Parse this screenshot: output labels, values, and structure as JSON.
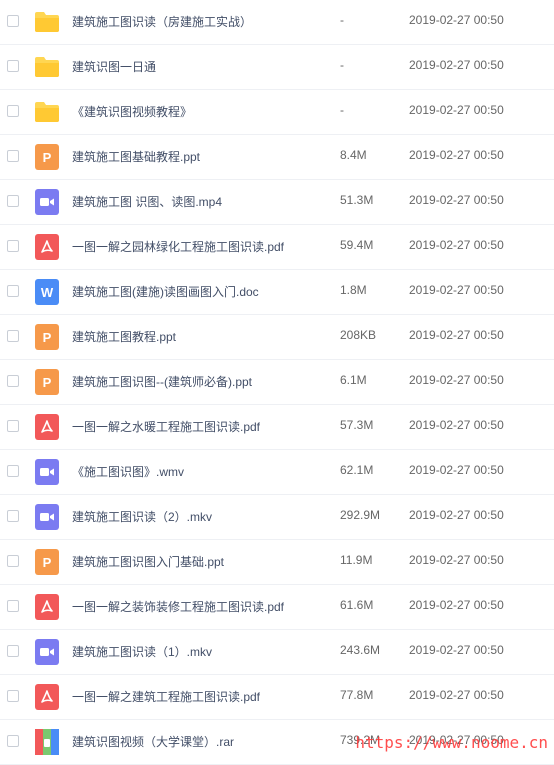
{
  "files": [
    {
      "name": "建筑施工图识读（房建施工实战）",
      "size": "-",
      "date": "2019-02-27 00:50",
      "type": "folder",
      "icon": "folder-icon"
    },
    {
      "name": "建筑识图一日通",
      "size": "-",
      "date": "2019-02-27 00:50",
      "type": "folder",
      "icon": "folder-icon"
    },
    {
      "name": "《建筑识图视频教程》",
      "size": "-",
      "date": "2019-02-27 00:50",
      "type": "folder",
      "icon": "folder-icon"
    },
    {
      "name": "建筑施工图基础教程.ppt",
      "size": "8.4M",
      "date": "2019-02-27 00:50",
      "type": "ppt",
      "icon": "ppt-file-icon"
    },
    {
      "name": "建筑施工图 识图、读图.mp4",
      "size": "51.3M",
      "date": "2019-02-27 00:50",
      "type": "video",
      "icon": "video-file-icon"
    },
    {
      "name": "一图一解之园林绿化工程施工图识读.pdf",
      "size": "59.4M",
      "date": "2019-02-27 00:50",
      "type": "pdf",
      "icon": "pdf-file-icon"
    },
    {
      "name": "建筑施工图(建施)读图画图入门.doc",
      "size": "1.8M",
      "date": "2019-02-27 00:50",
      "type": "doc",
      "icon": "word-file-icon"
    },
    {
      "name": "建筑施工图教程.ppt",
      "size": "208KB",
      "date": "2019-02-27 00:50",
      "type": "ppt",
      "icon": "ppt-file-icon"
    },
    {
      "name": "建筑施工图识图--(建筑师必备).ppt",
      "size": "6.1M",
      "date": "2019-02-27 00:50",
      "type": "ppt",
      "icon": "ppt-file-icon"
    },
    {
      "name": "一图一解之水暖工程施工图识读.pdf",
      "size": "57.3M",
      "date": "2019-02-27 00:50",
      "type": "pdf",
      "icon": "pdf-file-icon"
    },
    {
      "name": "《施工图识图》.wmv",
      "size": "62.1M",
      "date": "2019-02-27 00:50",
      "type": "video",
      "icon": "video-file-icon"
    },
    {
      "name": "建筑施工图识读（2）.mkv",
      "size": "292.9M",
      "date": "2019-02-27 00:50",
      "type": "video",
      "icon": "video-file-icon"
    },
    {
      "name": "建筑施工图识图入门基础.ppt",
      "size": "11.9M",
      "date": "2019-02-27 00:50",
      "type": "ppt",
      "icon": "ppt-file-icon"
    },
    {
      "name": "一图一解之装饰装修工程施工图识读.pdf",
      "size": "61.6M",
      "date": "2019-02-27 00:50",
      "type": "pdf",
      "icon": "pdf-file-icon"
    },
    {
      "name": "建筑施工图识读（1）.mkv",
      "size": "243.6M",
      "date": "2019-02-27 00:50",
      "type": "video",
      "icon": "video-file-icon"
    },
    {
      "name": "一图一解之建筑工程施工图识读.pdf",
      "size": "77.8M",
      "date": "2019-02-27 00:50",
      "type": "pdf",
      "icon": "pdf-file-icon"
    },
    {
      "name": "建筑识图视频（大学课堂）.rar",
      "size": "739.2M",
      "date": "2019-02-27 00:50",
      "type": "rar",
      "icon": "archive-file-icon"
    }
  ],
  "icon_letters": {
    "ppt": "P",
    "doc": "W"
  },
  "colors": {
    "folder": "#ffd652",
    "ppt": "#f6994a",
    "doc": "#4a8cf6",
    "pdf": "#f25859",
    "video": "#7b7bf1"
  },
  "watermark": "https://www.noome.cn"
}
